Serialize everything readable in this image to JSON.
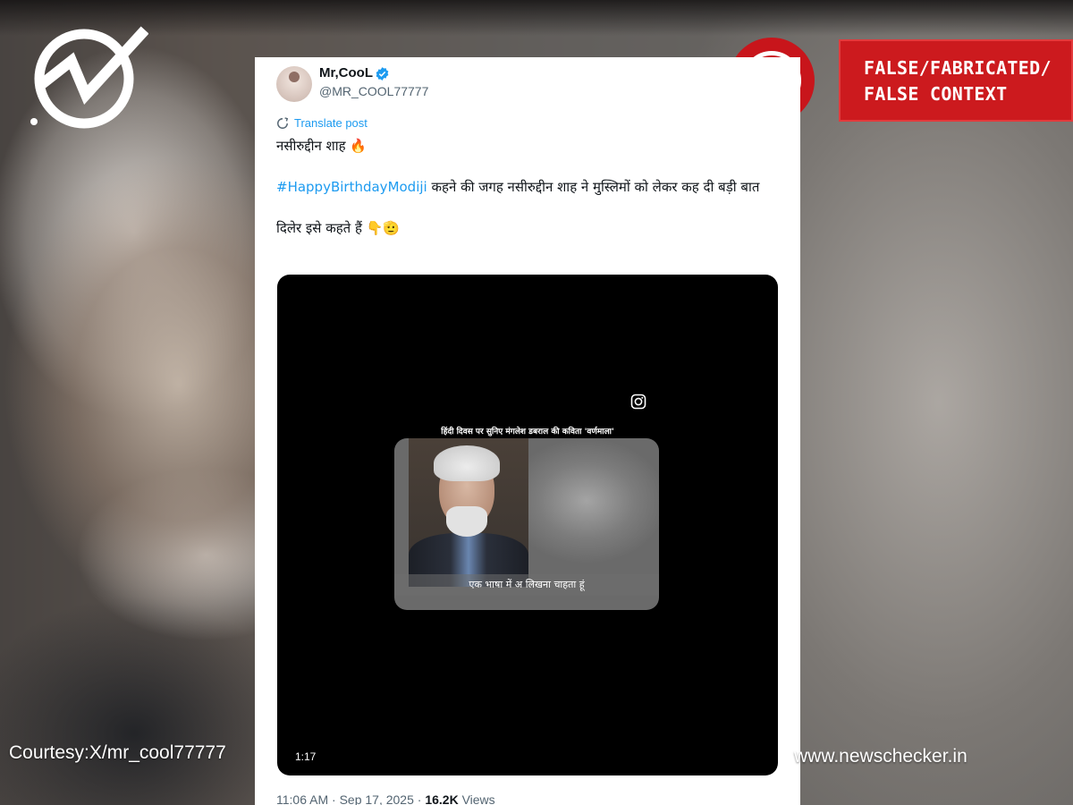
{
  "brand": {
    "logo_icon": "newschecker-check-icon",
    "site_url": "www.newschecker.in",
    "courtesy": "Courtesy:X/mr_cool77777"
  },
  "verdict": {
    "alert_icon": "exclamation-icon",
    "lines": [
      "FALSE/FABRICATED/",
      "FALSE CONTEXT"
    ],
    "color": "#cc1a1e"
  },
  "tweet": {
    "author_name": "Mr,CooL",
    "handle": "@MR_COOL77777",
    "verified_icon": "verified-badge-icon",
    "translate_label": "Translate post",
    "line1": "नसीरुद्दीन शाह 🔥",
    "hashtag": "#HappyBirthdayModiji",
    "line2_rest": " कहने की जगह नसीरुद्दीन शाह ने मुस्लिमों को लेकर कह दी बड़ी बात",
    "line3": "दिलेर इसे कहते हैं 👇🫡",
    "video": {
      "caption": "हिंदी दिवस पर सुनिए मंगलेश डबराल की कविता 'वर्णमाला'",
      "subtitle": "एक भाषा में अ लिखना चाहता हूं",
      "duration": "1:17",
      "watermark_icon": "instagram-icon"
    },
    "time": "11:06 AM",
    "date": "Sep 17, 2025",
    "views_count": "16.2K",
    "views_label": "Views",
    "link_color": "#1d9bf0"
  }
}
